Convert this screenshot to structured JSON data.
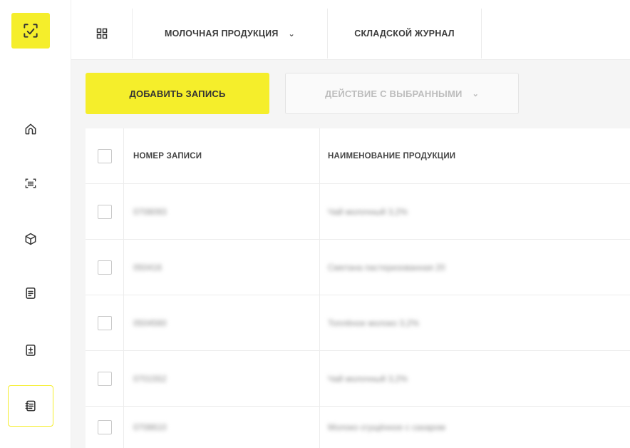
{
  "sidebar": {
    "items": [
      {
        "id": "home",
        "icon": "home-icon"
      },
      {
        "id": "scan",
        "icon": "scan-icon"
      },
      {
        "id": "products",
        "icon": "box-icon"
      },
      {
        "id": "documents",
        "icon": "document-icon"
      },
      {
        "id": "adjust",
        "icon": "plus-minus-icon"
      },
      {
        "id": "journal",
        "icon": "journal-icon",
        "active": true
      }
    ],
    "accent": "#f5ee2b"
  },
  "header": {
    "tabs": [
      {
        "label": "МОЛОЧНАЯ ПРОДУКЦИЯ",
        "has_dropdown": true
      },
      {
        "label": "СКЛАДСКОЙ ЖУРНАЛ"
      }
    ]
  },
  "toolbar": {
    "add_label": "ДОБАВИТЬ ЗАПИСЬ",
    "action_label": "ДЕЙСТВИЕ С ВЫБРАННЫМИ"
  },
  "table": {
    "columns": [
      "НОМЕР ЗАПИСИ",
      "НАИМЕНОВАНИЕ ПРОДУКЦИИ"
    ],
    "rows": [
      {
        "number": "0708093",
        "name": "Чай молочный 3,2%"
      },
      {
        "number": "050416",
        "name": "Сметана пастеризованная 20"
      },
      {
        "number": "0504560",
        "name": "Топлёное молоко 3,2%"
      },
      {
        "number": "0701552",
        "name": "Чай молочный 3,2%"
      },
      {
        "number": "0708610",
        "name": "Молоко сгущённое с сахаром"
      }
    ]
  }
}
